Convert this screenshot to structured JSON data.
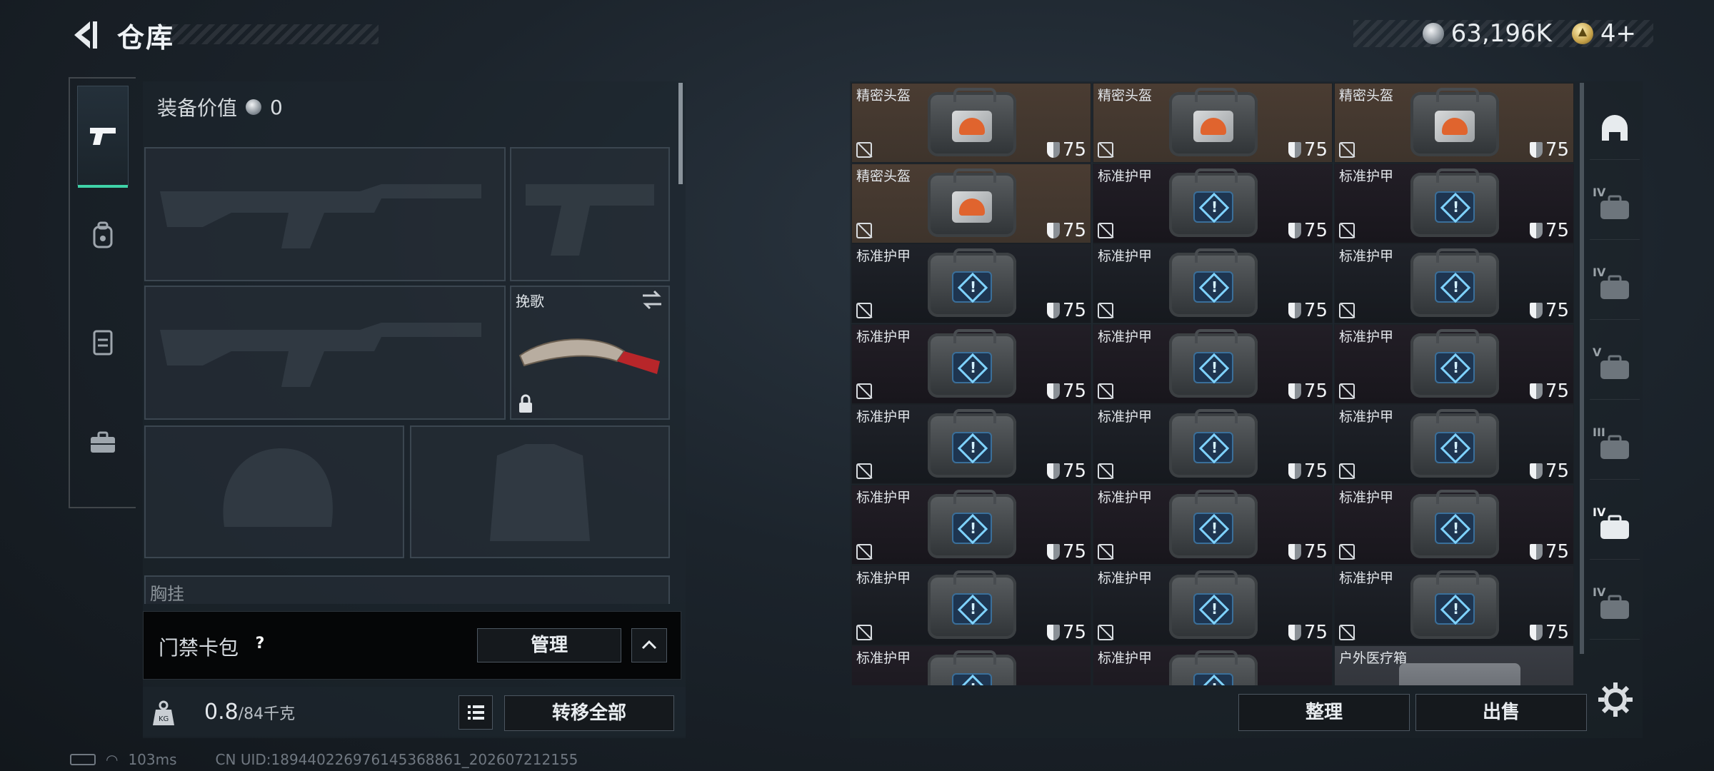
{
  "header": {
    "title": "仓库"
  },
  "currency": {
    "silver": "63,196K",
    "gold": "4+"
  },
  "equipment": {
    "value_label": "装备价值",
    "value": "0",
    "knife_slot_label": "挽歌",
    "chest_rig_label": "胸挂"
  },
  "card_pack": {
    "label": "门禁卡包",
    "help": "?",
    "manage_label": "管理"
  },
  "weight": {
    "current": "0.8",
    "max": "/84千克",
    "transfer_all_label": "转移全部"
  },
  "status": {
    "ping": "103ms",
    "uid": "CN UID:18944022697614536886​1_202607212155"
  },
  "inventory": {
    "items": [
      {
        "name": "精密头盔",
        "durability": "75",
        "kind": "helmet"
      },
      {
        "name": "精密头盔",
        "durability": "75",
        "kind": "helmet"
      },
      {
        "name": "精密头盔",
        "durability": "75",
        "kind": "helmet"
      },
      {
        "name": "精密头盔",
        "durability": "75",
        "kind": "helmet"
      },
      {
        "name": "标准护甲",
        "durability": "75",
        "kind": "armor"
      },
      {
        "name": "标准护甲",
        "durability": "75",
        "kind": "armor"
      },
      {
        "name": "标准护甲",
        "durability": "75",
        "kind": "armor"
      },
      {
        "name": "标准护甲",
        "durability": "75",
        "kind": "armor"
      },
      {
        "name": "标准护甲",
        "durability": "75",
        "kind": "armor"
      },
      {
        "name": "标准护甲",
        "durability": "75",
        "kind": "armor"
      },
      {
        "name": "标准护甲",
        "durability": "75",
        "kind": "armor"
      },
      {
        "name": "标准护甲",
        "durability": "75",
        "kind": "armor"
      },
      {
        "name": "标准护甲",
        "durability": "75",
        "kind": "armor"
      },
      {
        "name": "标准护甲",
        "durability": "75",
        "kind": "armor"
      },
      {
        "name": "标准护甲",
        "durability": "75",
        "kind": "armor"
      },
      {
        "name": "标准护甲",
        "durability": "75",
        "kind": "armor"
      },
      {
        "name": "标准护甲",
        "durability": "75",
        "kind": "armor"
      },
      {
        "name": "标准护甲",
        "durability": "75",
        "kind": "armor"
      },
      {
        "name": "标准护甲",
        "durability": "75",
        "kind": "armor"
      },
      {
        "name": "标准护甲",
        "durability": "75",
        "kind": "armor"
      },
      {
        "name": "标准护甲",
        "durability": "75",
        "kind": "armor"
      },
      {
        "name": "标准护甲",
        "durability": "",
        "kind": "armor"
      },
      {
        "name": "标准护甲",
        "durability": "",
        "kind": "armor"
      },
      {
        "name": "户外医疗箱",
        "durability": "",
        "kind": "medkit"
      }
    ],
    "sort_label": "整理",
    "sell_label": "出售"
  },
  "filters": [
    {
      "icon": "helmet-filter-icon",
      "label": ""
    },
    {
      "icon": "armor-iv-filter-icon",
      "label": "IV"
    },
    {
      "icon": "armor-iv-filter-icon",
      "label": "IV"
    },
    {
      "icon": "armor-v-filter-icon",
      "label": "V"
    },
    {
      "icon": "armor-iii-filter-icon",
      "label": "III"
    },
    {
      "icon": "medkit-iv-filter-icon",
      "label": "IV"
    },
    {
      "icon": "medkit-iv-filter-icon",
      "label": "IV"
    }
  ],
  "colors": {
    "accent": "#3fd2a8",
    "helmet_bg": "#4a3c32",
    "armor_bg": "#1f2229"
  }
}
